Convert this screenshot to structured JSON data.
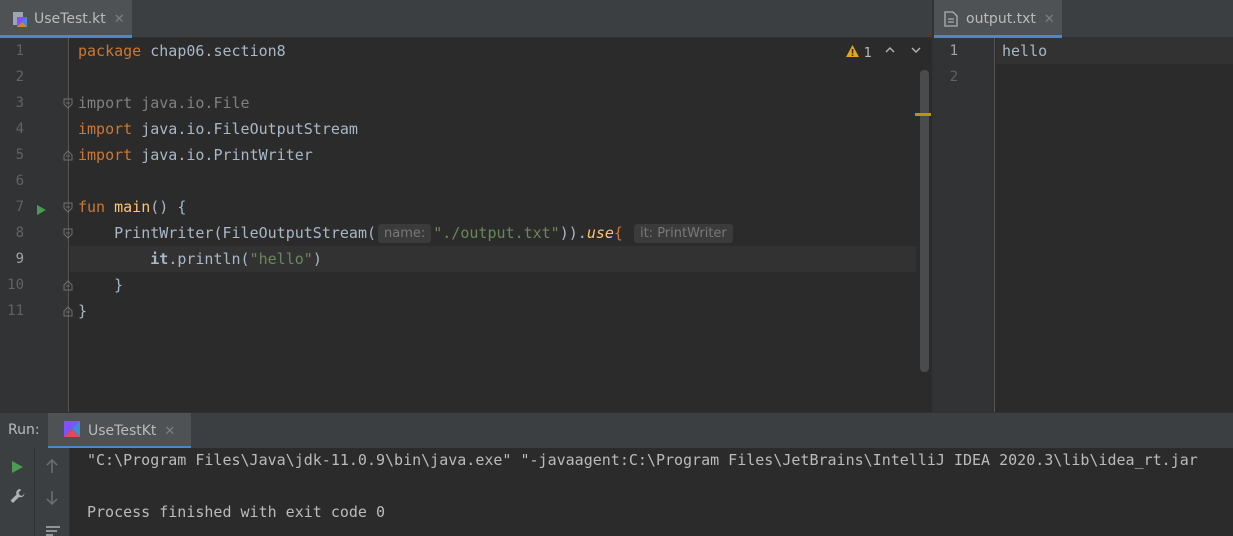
{
  "left_editor": {
    "tab_title": "UseTest.kt",
    "tab_close": "✕",
    "warning_count": "1",
    "line_numbers": [
      "1",
      "2",
      "3",
      "4",
      "5",
      "6",
      "7",
      "8",
      "9",
      "10",
      "11"
    ],
    "code": {
      "l1_kw": "package",
      "l1_rest": " chap06.section8",
      "l3_kw": "import",
      "l3_rest": " java.io.File",
      "l4_kw": "import",
      "l4_rest": " java.io.FileOutputStream",
      "l5_kw": "import",
      "l5_rest": " java.io.PrintWriter",
      "l7_kw": "fun",
      "l7_fn": "main",
      "l7_rest": "() {",
      "l8_a": "PrintWriter(FileOutputStream(",
      "l8_hint": "name:",
      "l8_str": "\"./output.txt\"",
      "l8_b": ")).",
      "l8_use": "use",
      "l8_brace": "{",
      "l8_hint2": "it: PrintWriter",
      "l9_it": "it",
      "l9_a": ".println(",
      "l9_str": "\"hello\"",
      "l9_b": ")",
      "l10": "}",
      "l11": "}"
    }
  },
  "right_editor": {
    "tab_title": "output.txt",
    "tab_close": "✕",
    "line_numbers": [
      "1",
      "2"
    ],
    "content": "hello"
  },
  "run_panel": {
    "label": "Run:",
    "tab_title": "UseTestKt",
    "tab_close": "✕",
    "lines": [
      "\"C:\\Program Files\\Java\\jdk-11.0.9\\bin\\java.exe\" \"-javaagent:C:\\Program Files\\JetBrains\\IntelliJ IDEA 2020.3\\lib\\idea_rt.jar",
      "Process finished with exit code 0"
    ]
  },
  "colors": {
    "keyword": "#cc7832",
    "function": "#ffc66d",
    "string": "#6a8759",
    "warning": "#e2a51b",
    "run_green": "#499c54"
  }
}
